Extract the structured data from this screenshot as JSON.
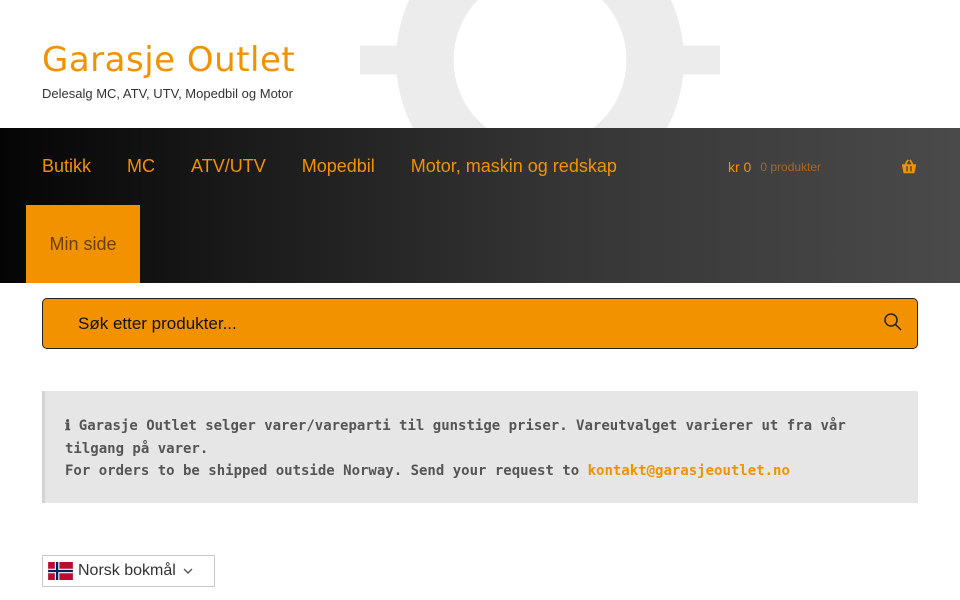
{
  "header": {
    "title": "Garasje Outlet",
    "tagline": "Delesalg MC, ATV, UTV, Mopedbil og Motor"
  },
  "nav": {
    "items": [
      "Butikk",
      "MC",
      "ATV/UTV",
      "Mopedbil",
      "Motor, maskin og redskap"
    ],
    "active_item": "Min side"
  },
  "cart": {
    "total": "kr 0",
    "count": "0 produkter",
    "icon": "basket-icon"
  },
  "search": {
    "placeholder": "Søk etter produkter...",
    "icon": "search-icon"
  },
  "notice": {
    "icon": "ℹ",
    "line1": "Garasje Outlet selger varer/vareparti til gunstige priser. Vareutvalget varierer ut fra vår tilgang på varer.",
    "line2": "For orders to be shipped outside Norway. Send your request to",
    "email": "kontakt@garasjeoutlet.no"
  },
  "language": {
    "selected": "Norsk bokmål",
    "flag": "norway-flag-icon"
  },
  "colors": {
    "accent": "#f39200",
    "nav_bg_dark": "#050505",
    "notice_bg": "#e6e6e6"
  }
}
